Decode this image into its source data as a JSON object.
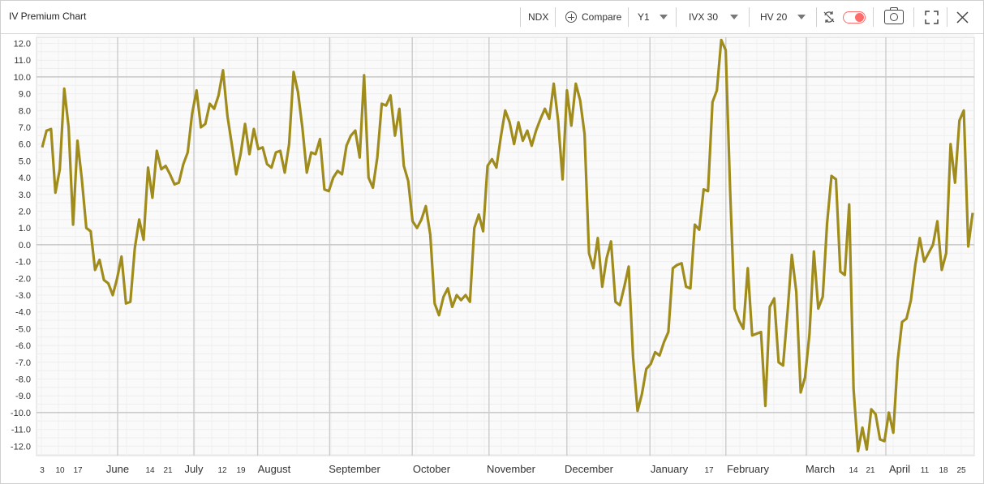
{
  "header": {
    "title": "IV Premium Chart",
    "ticker": "NDX",
    "compare_label": "Compare",
    "period": "Y1",
    "iv_measure": "IVX 30",
    "hv_measure": "HV 20"
  },
  "colors": {
    "line": "#a08c1c",
    "toggle": "#ff6b6b"
  },
  "chart_data": {
    "type": "line",
    "title": "",
    "xlabel": "",
    "ylabel": "",
    "ylim": [
      -12.5,
      12.5
    ],
    "grid": true,
    "y_ticks": [
      "12.0",
      "11.0",
      "10.0",
      "9.0",
      "8.0",
      "7.0",
      "6.0",
      "5.0",
      "4.0",
      "3.0",
      "2.0",
      "1.0",
      "0.0",
      "-1.0",
      "-2.0",
      "-3.0",
      "-4.0",
      "-5.0",
      "-6.0",
      "-7.0",
      "-8.0",
      "-9.0",
      "-10.0",
      "-11.0",
      "-12.0"
    ],
    "x_labels": [
      {
        "text": "3",
        "kind": "day"
      },
      {
        "text": "10",
        "kind": "day"
      },
      {
        "text": "17",
        "kind": "day"
      },
      {
        "text": "June",
        "kind": "month"
      },
      {
        "text": "14",
        "kind": "day"
      },
      {
        "text": "21",
        "kind": "day"
      },
      {
        "text": "July",
        "kind": "month"
      },
      {
        "text": "12",
        "kind": "day"
      },
      {
        "text": "19",
        "kind": "day"
      },
      {
        "text": "August",
        "kind": "month"
      },
      {
        "text": "September",
        "kind": "month"
      },
      {
        "text": "October",
        "kind": "month"
      },
      {
        "text": "November",
        "kind": "month"
      },
      {
        "text": "December",
        "kind": "month"
      },
      {
        "text": "January",
        "kind": "month"
      },
      {
        "text": "17",
        "kind": "day"
      },
      {
        "text": "February",
        "kind": "month"
      },
      {
        "text": "March",
        "kind": "month"
      },
      {
        "text": "14",
        "kind": "day"
      },
      {
        "text": "21",
        "kind": "day"
      },
      {
        "text": "April",
        "kind": "month"
      },
      {
        "text": "11",
        "kind": "day"
      },
      {
        "text": "18",
        "kind": "day"
      },
      {
        "text": "25",
        "kind": "day"
      }
    ],
    "series": [
      {
        "values": [
          5.8,
          6.8,
          6.9,
          3.1,
          4.5,
          9.3,
          7.0,
          1.2,
          6.2,
          3.9,
          1.0,
          0.8,
          -1.5,
          -0.9,
          -2.1,
          -2.3,
          -3.0,
          -2.0,
          -0.7,
          -3.5,
          -3.4,
          -0.2,
          1.5,
          0.3,
          4.6,
          2.8,
          5.6,
          4.5,
          4.7,
          4.2,
          3.6,
          3.7,
          4.8,
          5.5,
          7.8,
          9.2,
          7.0,
          7.2,
          8.4,
          8.1,
          8.9,
          10.4,
          7.7,
          6.0,
          4.2,
          5.4,
          7.2,
          5.4,
          6.9,
          5.7,
          5.8,
          4.8,
          4.6,
          5.5,
          5.6,
          4.3,
          6.0,
          10.3,
          9.1,
          7.0,
          4.3,
          5.5,
          5.4,
          6.3,
          3.3,
          3.2,
          4.0,
          4.4,
          4.2,
          5.9,
          6.5,
          6.8,
          5.2,
          10.1,
          4.0,
          3.4,
          5.2,
          8.4,
          8.3,
          8.9,
          6.5,
          8.1,
          4.7,
          3.8,
          1.4,
          1.0,
          1.5,
          2.3,
          0.6,
          -3.5,
          -4.2,
          -3.1,
          -2.6,
          -3.7,
          -3.0,
          -3.3,
          -3.0,
          -3.4,
          1.0,
          1.8,
          0.8,
          4.7,
          5.1,
          4.6,
          6.4,
          8.0,
          7.3,
          6.0,
          7.3,
          6.2,
          6.8,
          5.9,
          6.8,
          7.5,
          8.1,
          7.5,
          9.6,
          7.4,
          3.9,
          9.2,
          7.1,
          9.6,
          8.6,
          6.6,
          -0.5,
          -1.4,
          0.4,
          -2.5,
          -0.8,
          0.2,
          -3.4,
          -3.6,
          -2.5,
          -1.3,
          -6.7,
          -9.9,
          -8.9,
          -7.4,
          -7.1,
          -6.4,
          -6.6,
          -5.8,
          -5.2,
          -1.4,
          -1.2,
          -1.1,
          -2.5,
          -2.6,
          1.2,
          0.9,
          3.3,
          3.2,
          8.5,
          9.2,
          12.2,
          11.6,
          3.3,
          -3.8,
          -4.5,
          -5.0,
          -1.4,
          -5.4,
          -5.3,
          -5.2,
          -9.6,
          -3.7,
          -3.2,
          -7.0,
          -7.2,
          -4.1,
          -0.6,
          -2.8,
          -8.8,
          -7.9,
          -5.3,
          -0.4,
          -3.8,
          -3.1,
          1.3,
          4.1,
          3.9,
          -1.6,
          -1.8,
          2.4,
          -8.6,
          -12.3,
          -10.9,
          -12.2,
          -9.8,
          -10.1,
          -11.6,
          -11.7,
          -10.0,
          -11.2,
          -6.9,
          -4.6,
          -4.4,
          -3.3,
          -1.2,
          0.4,
          -1.0,
          -0.5,
          0.0,
          1.4,
          -1.5,
          -0.5,
          6.0,
          3.7,
          7.4,
          8.0,
          -0.1,
          1.9
        ]
      }
    ]
  }
}
